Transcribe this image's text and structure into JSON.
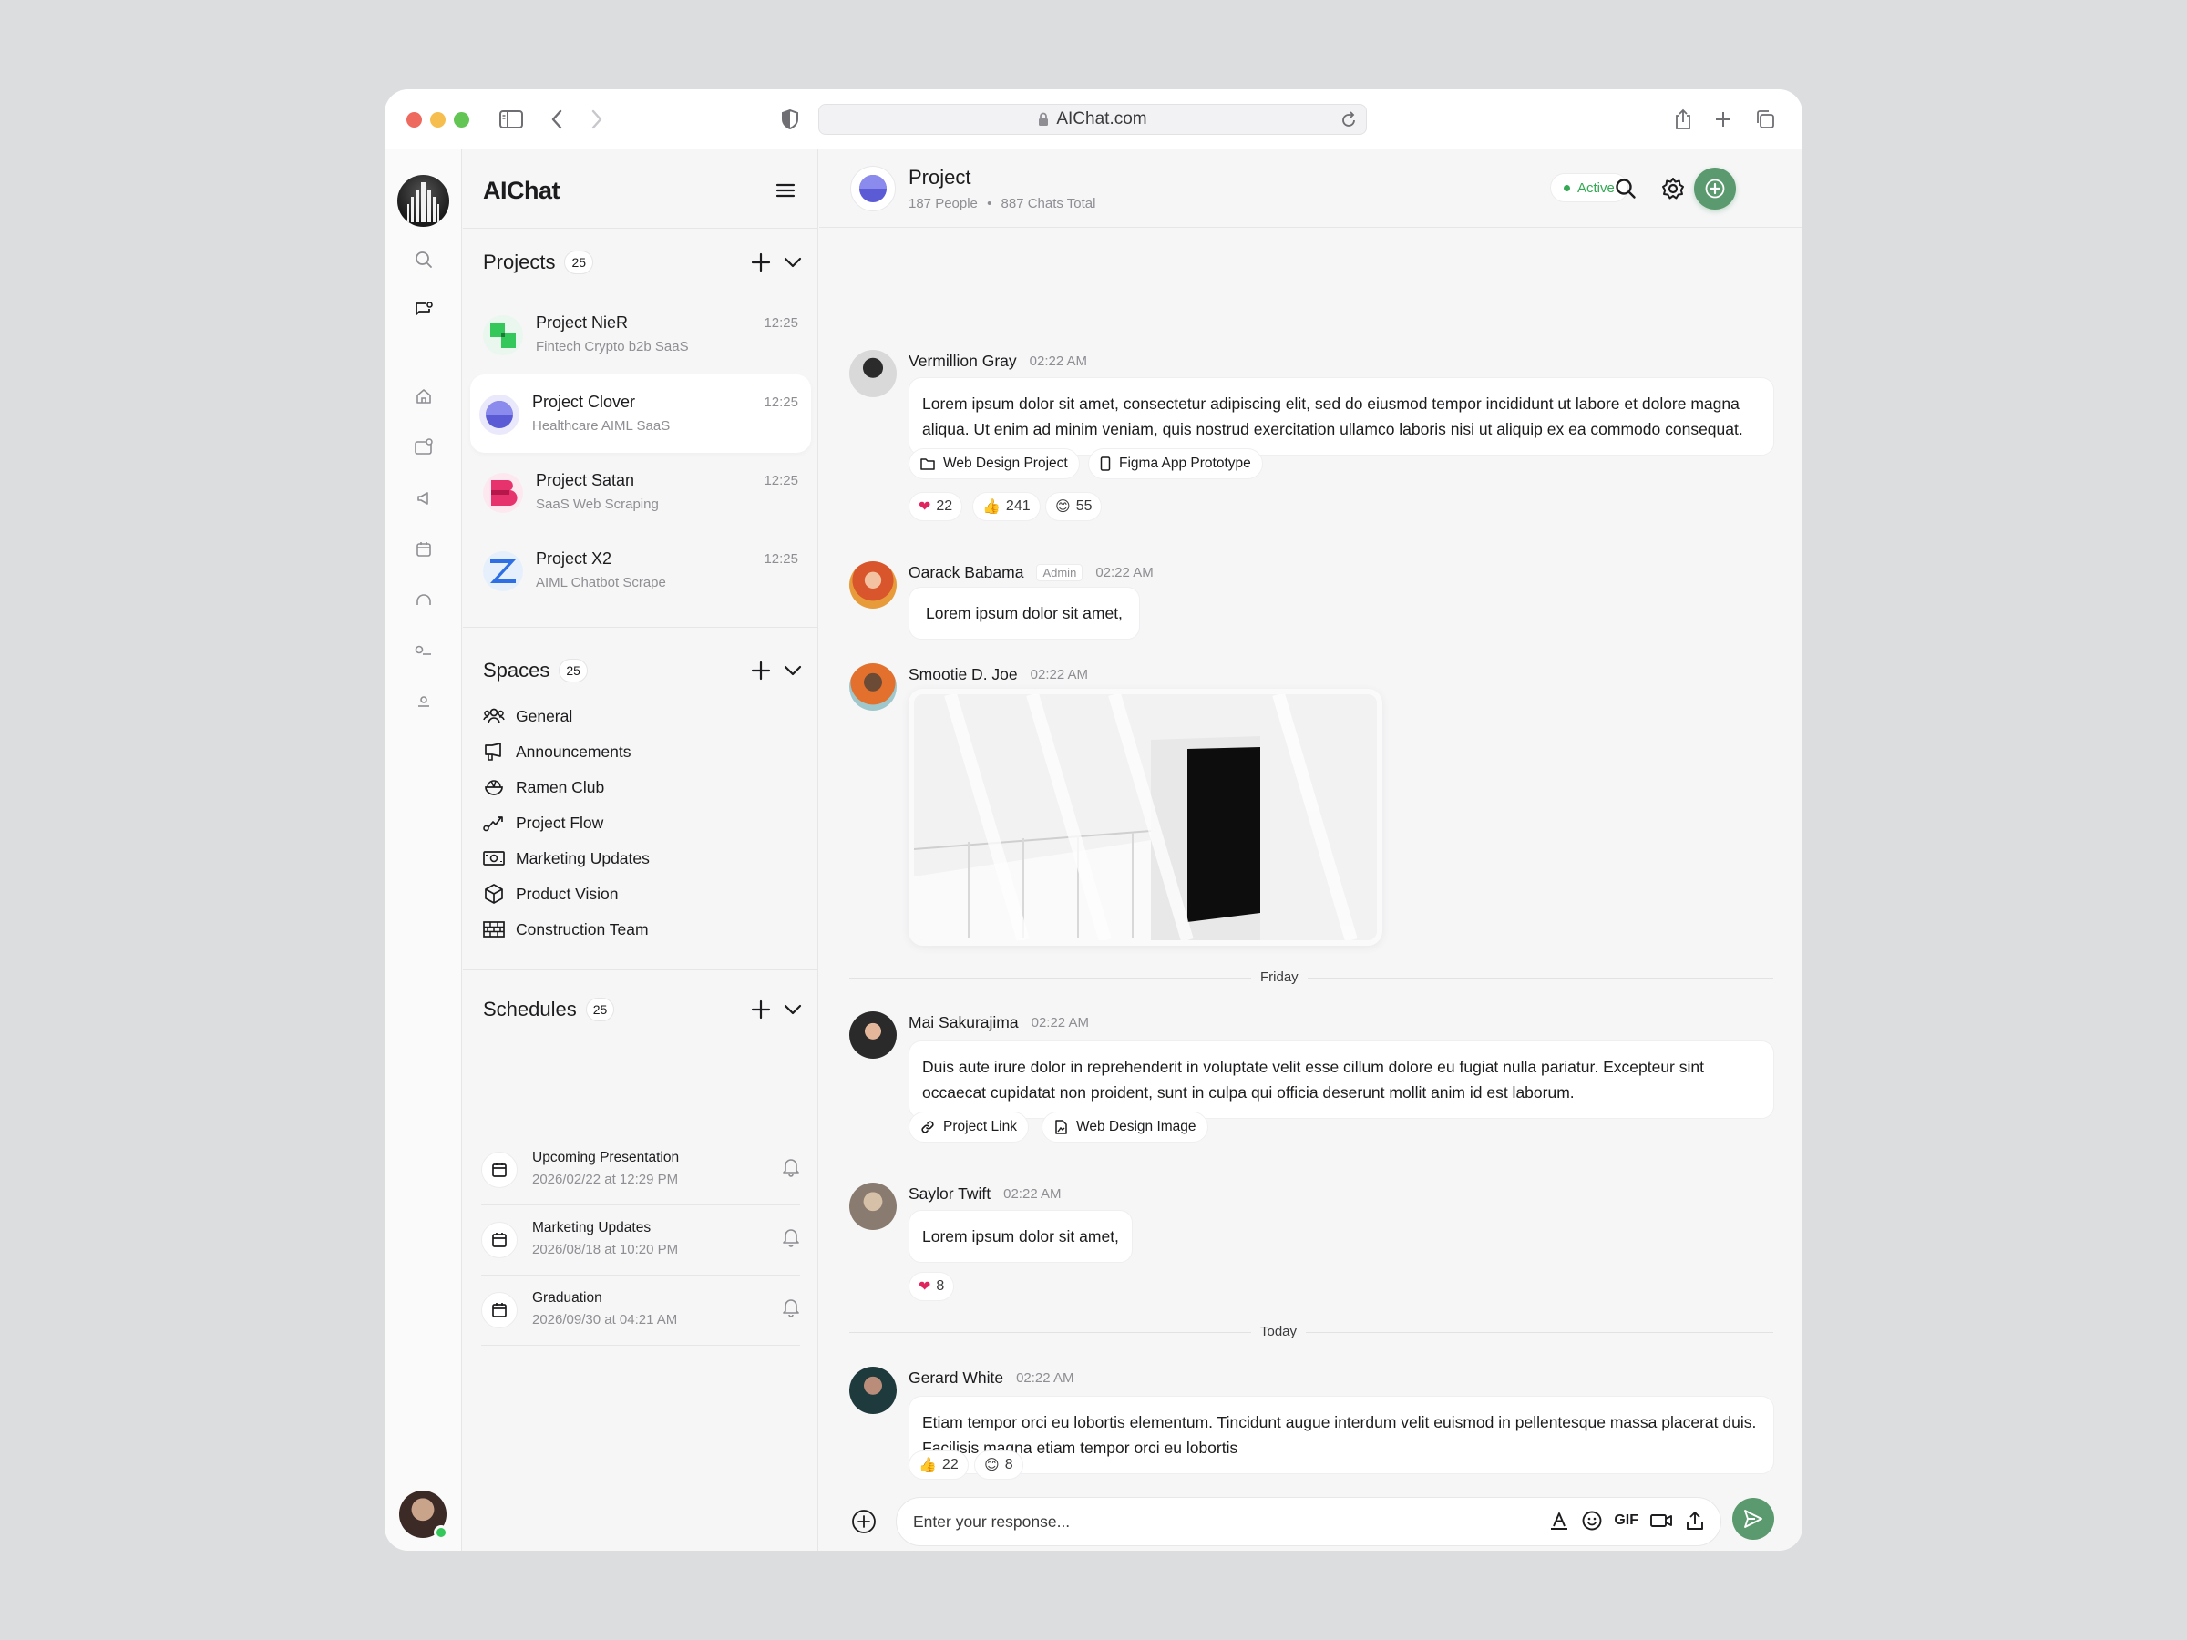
{
  "browser": {
    "url": "AIChat.com"
  },
  "app": {
    "title": "AIChat"
  },
  "projects": {
    "title": "Projects",
    "count": "25",
    "items": [
      {
        "name": "Project NieR",
        "sub": "Fintech Crypto b2b SaaS",
        "time": "12:25"
      },
      {
        "name": "Project Clover",
        "sub": "Healthcare AIML SaaS",
        "time": "12:25"
      },
      {
        "name": "Project Satan",
        "sub": "SaaS Web Scraping",
        "time": "12:25"
      },
      {
        "name": "Project X2",
        "sub": "AIML Chatbot Scrape",
        "time": "12:25"
      }
    ]
  },
  "spaces": {
    "title": "Spaces",
    "count": "25",
    "items": [
      "General",
      "Announcements",
      "Ramen Club",
      "Project Flow",
      "Marketing Updates",
      "Product Vision",
      "Construction Team"
    ]
  },
  "schedules": {
    "title": "Schedules",
    "count": "25",
    "items": [
      {
        "title": "Upcoming Presentation",
        "date": "2026/02/22 at 12:29 PM"
      },
      {
        "title": "Marketing Updates",
        "date": "2026/08/18 at 10:20 PM"
      },
      {
        "title": "Graduation",
        "date": "2026/09/30 at 04:21 AM"
      }
    ]
  },
  "header": {
    "title": "Project",
    "people": "187 People",
    "chats": "887 Chats Total",
    "status": "Active"
  },
  "messages": [
    {
      "name": "Vermillion Gray",
      "time": "02:22 AM",
      "text": "Lorem ipsum dolor sit amet, consectetur adipiscing elit, sed do eiusmod tempor incididunt ut labore et dolore magna aliqua. Ut enim ad minim veniam, quis nostrud exercitation ullamco laboris nisi ut aliquip ex ea commodo consequat.",
      "chips": [
        "Web Design Project",
        "Figma App Prototype"
      ],
      "reactions": [
        "22",
        "241",
        "55"
      ]
    },
    {
      "name": "Oarack Babama",
      "badge": "Admin",
      "time": "02:22 AM",
      "text": "Lorem ipsum dolor sit amet,"
    },
    {
      "name": "Smootie D. Joe",
      "time": "02:22 AM"
    },
    {
      "name": "Mai Sakurajima",
      "time": "02:22 AM",
      "text": "Duis aute irure dolor in reprehenderit in voluptate velit esse cillum dolore eu fugiat nulla pariatur. Excepteur sint occaecat cupidatat non proident, sunt in culpa qui officia deserunt mollit anim id est laborum.",
      "chips": [
        "Project Link",
        "Web Design Image"
      ]
    },
    {
      "name": "Saylor Twift",
      "time": "02:22 AM",
      "text": "Lorem ipsum dolor sit amet,",
      "reactions": [
        "8"
      ]
    },
    {
      "name": "Gerard White",
      "time": "02:22 AM",
      "text": "Etiam tempor orci eu lobortis elementum. Tincidunt augue interdum velit euismod in pellentesque massa placerat duis. Facilisis magna etiam tempor orci eu lobortis",
      "reactions": [
        "22",
        "8"
      ]
    }
  ],
  "dividers": [
    "Friday",
    "Today"
  ],
  "composer": {
    "placeholder": "Enter your response...",
    "gif": "GIF"
  }
}
